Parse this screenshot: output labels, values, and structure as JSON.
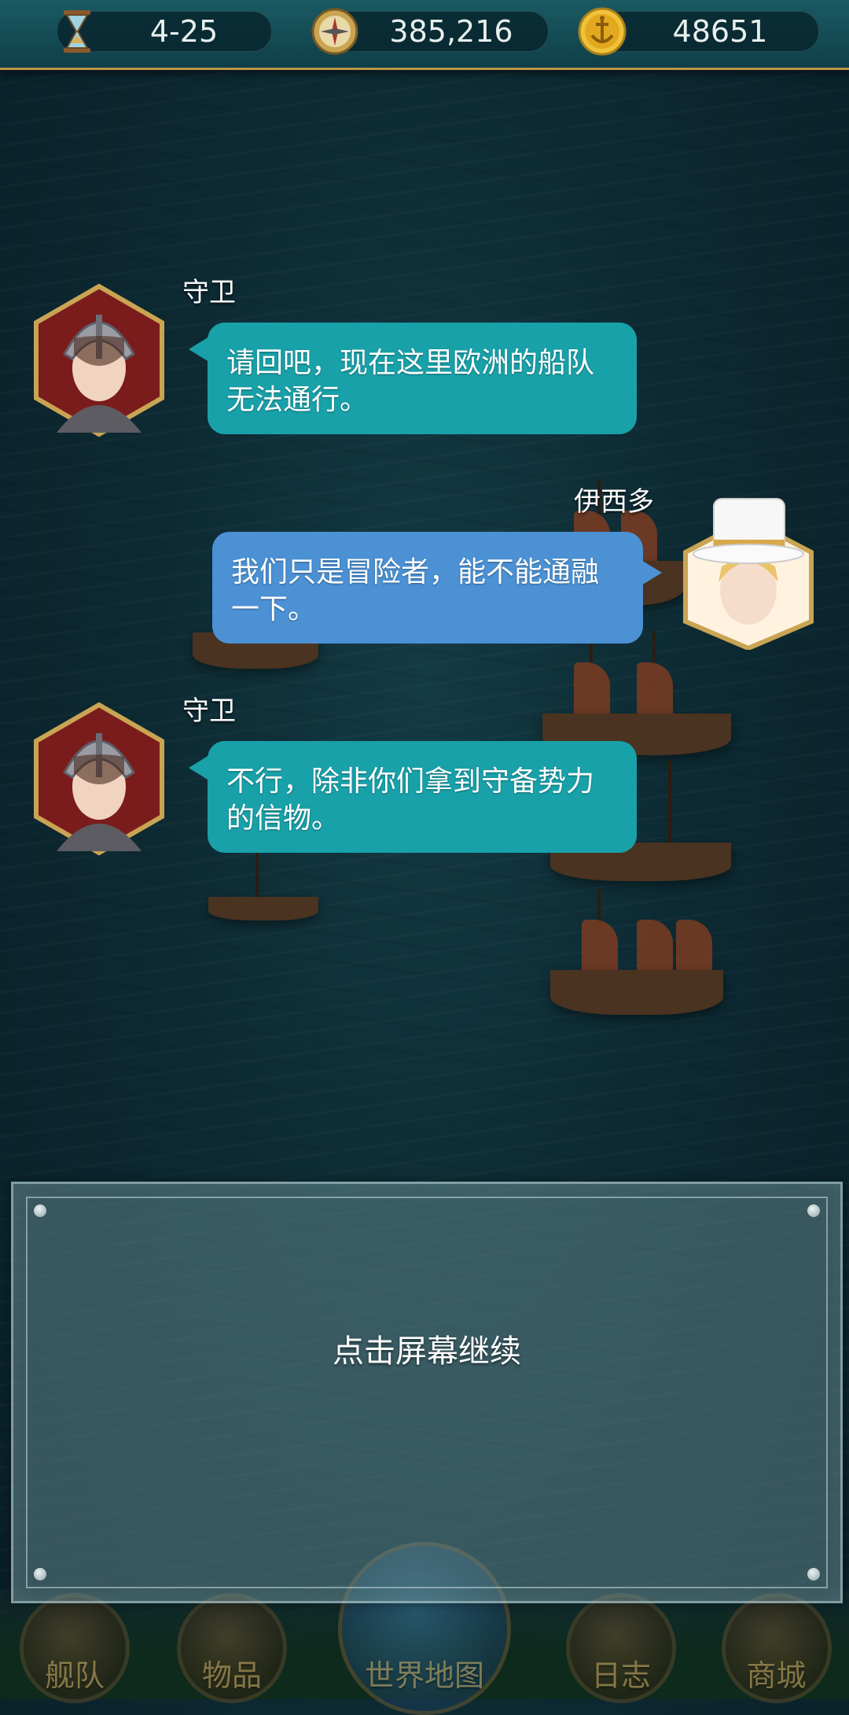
{
  "topbar": {
    "resources": [
      {
        "icon": "hourglass-icon",
        "value": "4-25"
      },
      {
        "icon": "compass-icon",
        "value": "385,216"
      },
      {
        "icon": "gold-anchor-coin-icon",
        "value": "48651"
      }
    ]
  },
  "dialog": [
    {
      "speaker": "守卫",
      "side": "left",
      "text": "请回吧，现在这里欧洲的船队无法通行。",
      "color": "#19a1a9"
    },
    {
      "speaker": "伊西多",
      "side": "right",
      "text": "我们只是冒险者，能不能通融一下。",
      "color": "#4b91d4"
    },
    {
      "speaker": "守卫",
      "side": "left",
      "text": "不行，除非你们拿到守备势力的信物。",
      "color": "#19a1a9"
    }
  ],
  "panel": {
    "prompt": "点击屏幕继续"
  },
  "nav": [
    {
      "label": "舰队",
      "icon": "ship-wheel-icon"
    },
    {
      "label": "物品",
      "icon": "bag-icon"
    },
    {
      "label": "世界地图",
      "icon": "globe-icon"
    },
    {
      "label": "日志",
      "icon": "journal-icon"
    },
    {
      "label": "商城",
      "icon": "treasure-chest-icon"
    }
  ]
}
